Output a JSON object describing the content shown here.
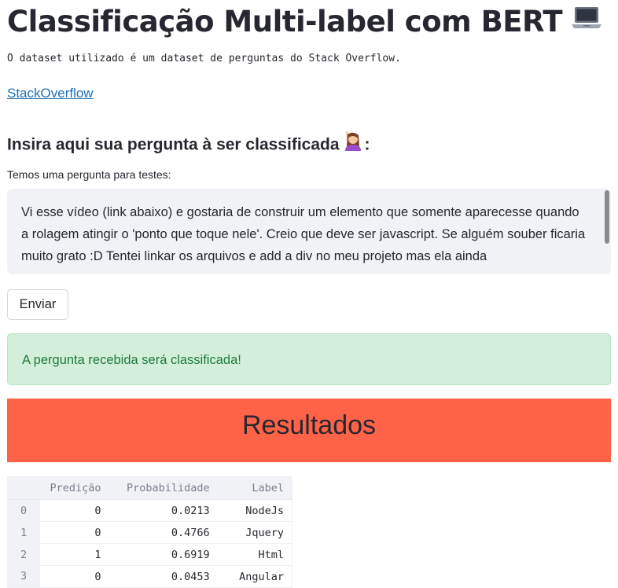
{
  "page": {
    "title": "Classificação Multi-label com BERT",
    "title_icon": "laptop-icon",
    "description": "O dataset utilizado é um dataset de perguntas do Stack Overflow.",
    "link_text": "StackOverflow"
  },
  "question": {
    "heading_prefix": "Insira aqui sua pergunta à ser classificada",
    "heading_icon": "person-raising-hand-icon",
    "heading_suffix": ":",
    "textarea_label": "Temos uma pergunta para testes:",
    "textarea_value_visible": "Vi esse vídeo (link abaixo) e gostaria de construir um elemento que somente aparecesse quando a rolagem atingir o 'ponto que toque nele'. Creio que deve ser javascript. Se alguém souber ficaria muito grato :D Tentei linkar os arquivos e add a div no meu projeto mas ela",
    "textarea_value_partial": "ainda",
    "send_label": "Enviar"
  },
  "alert": {
    "text": "A pergunta recebida será classificada!",
    "bg_color": "#d3eedb",
    "text_color": "#1f7a3a"
  },
  "results": {
    "title": "Resultados",
    "banner_color": "#ff6347",
    "table": {
      "columns": [
        "Predição",
        "Probabilidade",
        "Label"
      ],
      "rows": [
        {
          "index": "0",
          "pred": "0",
          "prob": "0.0213",
          "label": "NodeJs"
        },
        {
          "index": "1",
          "pred": "0",
          "prob": "0.4766",
          "label": "Jquery"
        },
        {
          "index": "2",
          "pred": "1",
          "prob": "0.6919",
          "label": "Html"
        },
        {
          "index": "3",
          "pred": "0",
          "prob": "0.0453",
          "label": "Angular"
        }
      ]
    }
  }
}
